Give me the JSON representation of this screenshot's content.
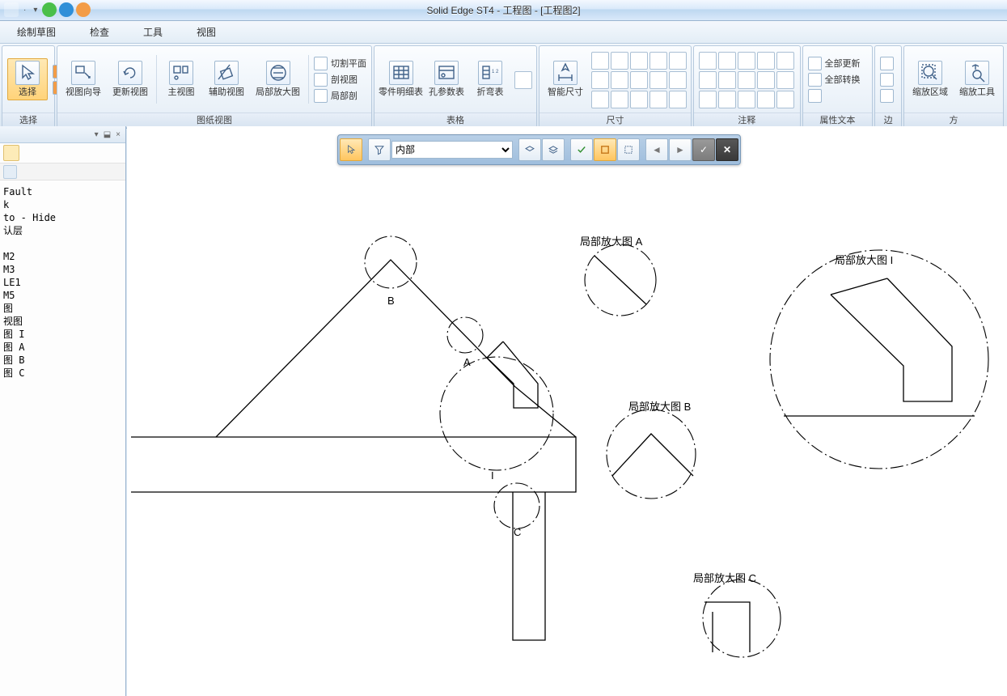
{
  "window": {
    "title": "Solid Edge ST4 - 工程图 - [工程图2]"
  },
  "menus": [
    "绘制草图",
    "检查",
    "工具",
    "视图"
  ],
  "ribbon": {
    "groups": [
      {
        "id": "select",
        "label": "选择",
        "bigButtons": [
          {
            "key": "select",
            "label": "选择",
            "selected": true
          }
        ],
        "sideStack": [
          "flag",
          "pin"
        ]
      },
      {
        "id": "drawing-views",
        "label": "图纸视图",
        "bigButtons": [
          {
            "key": "view-wizard",
            "label": "视图向导"
          },
          {
            "key": "update-view",
            "label": "更新视图"
          },
          {
            "key": "principal-view",
            "label": "主视图"
          },
          {
            "key": "aux-view",
            "label": "辅助视图"
          },
          {
            "key": "detail-view",
            "label": "局部放大图"
          }
        ],
        "miniItems": [
          {
            "key": "cut-plane",
            "label": "切割平面"
          },
          {
            "key": "section-view",
            "label": "剖视图"
          },
          {
            "key": "broken-section",
            "label": "局部剖"
          }
        ]
      },
      {
        "id": "tables",
        "label": "表格",
        "bigButtons": [
          {
            "key": "parts-list",
            "label": "零件明细表"
          },
          {
            "key": "hole-table",
            "label": "孔参数表"
          },
          {
            "key": "bend-table",
            "label": "折弯表"
          }
        ],
        "sideStack": [
          "t1"
        ]
      },
      {
        "id": "dimension",
        "label": "尺寸",
        "bigButtons": [
          {
            "key": "smart-dim",
            "label": "智能尺寸"
          }
        ],
        "iconGrid": "six"
      },
      {
        "id": "annotation",
        "label": "注释",
        "iconGrid": "six"
      },
      {
        "id": "attr-text",
        "label": "属性文本",
        "miniItems": [
          {
            "key": "update-all",
            "label": "全部更新"
          },
          {
            "key": "convert-all",
            "label": "全部转换"
          }
        ],
        "sideStack": [
          "at1"
        ]
      },
      {
        "id": "edges",
        "label": "边",
        "sideStack": [
          "e1",
          "e2",
          "e3"
        ]
      },
      {
        "id": "zoom",
        "label": "方",
        "bigButtons": [
          {
            "key": "zoom-area",
            "label": "缩放区域"
          },
          {
            "key": "zoom-tool",
            "label": "缩放工具"
          }
        ]
      }
    ]
  },
  "promptBar": {
    "selectValue": "内部",
    "options": [
      "内部"
    ]
  },
  "tree": {
    "lines": [
      "",
      "",
      "",
      "Fault",
      "k",
      "to - Hide",
      "认层",
      "",
      "M2",
      "M3",
      "LE1",
      "M5",
      "图",
      "视图",
      "图 I",
      "图 A",
      "图 B",
      "图 C"
    ]
  },
  "drawing": {
    "labels": {
      "B": "B",
      "A": "A",
      "I": "I",
      "C": "C",
      "detailA": "局部放大图 A",
      "detailB": "局部放大图 B",
      "detailC": "局部放大图 C",
      "detailI": "局部放大图 I"
    }
  }
}
